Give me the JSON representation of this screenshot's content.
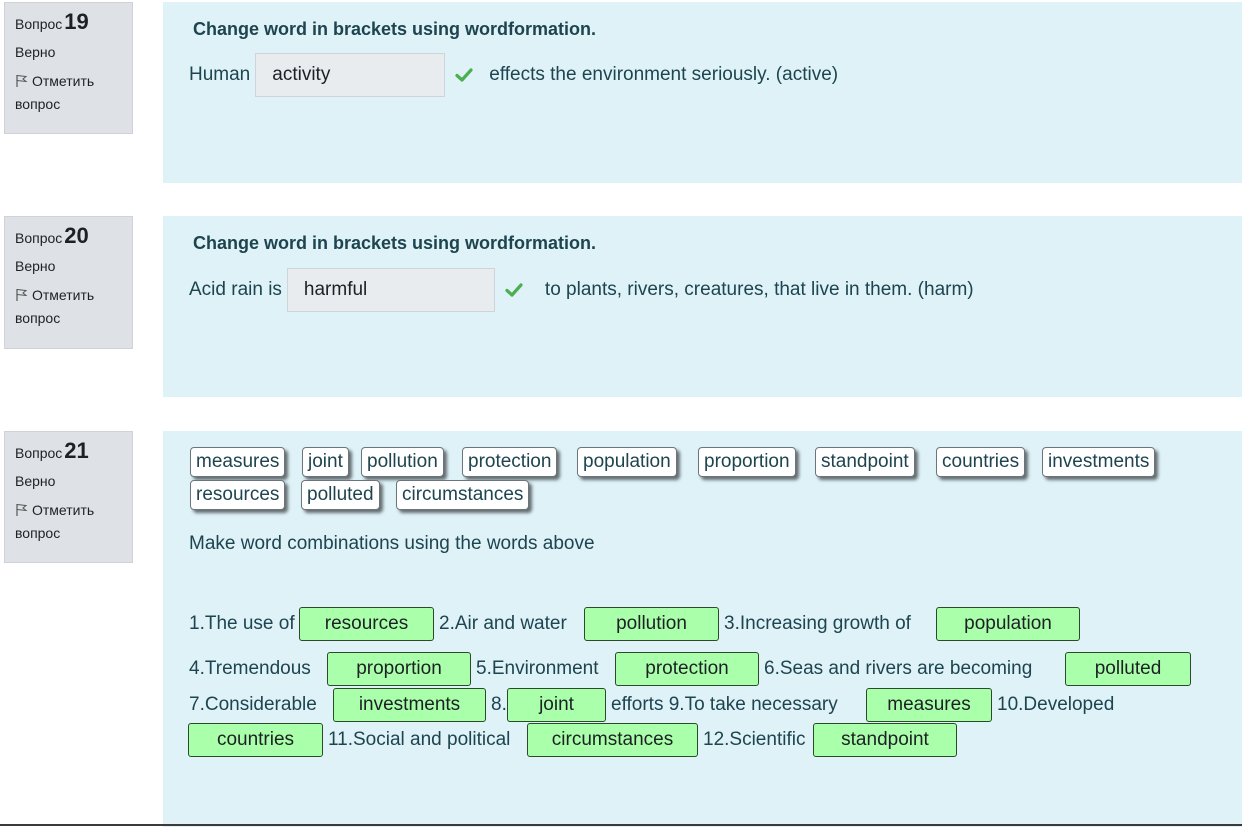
{
  "flag_label": "Отметить вопрос",
  "flag_icon": "flag-icon",
  "check_icon": "checkmark-icon",
  "colors": {
    "info_bg": "#dee2e6",
    "content_bg": "#def2f8",
    "drop_bg": "#aaffaa",
    "check": "#4caf50",
    "text": "#1e444f"
  },
  "questions": [
    {
      "label": "Вопрос",
      "number": "19",
      "state": "Верно",
      "title": "Change word in brackets using wordformation.",
      "before": "Human",
      "answer": "activity",
      "after": "effects the environment seriously. (active)"
    },
    {
      "label": "Вопрос",
      "number": "20",
      "state": "Верно",
      "title": "Change word in brackets using wordformation.",
      "before": "Acid rain is",
      "answer": "harmful",
      "after": "to plants, rivers, creatures, that live in them. (harm)"
    },
    {
      "label": "Вопрос",
      "number": "21",
      "state": "Верно",
      "chips": [
        "measures",
        "joint",
        "pollution",
        "protection",
        "population",
        "proportion",
        "standpoint",
        "countries",
        "investments",
        "resources",
        "polluted",
        "circumstances"
      ],
      "instruction": "Make word combinations using the words above",
      "texts": [
        "1.The use of",
        "2.Air and water",
        "3.Increasing growth of",
        "4.Tremendous",
        "5.Environment",
        "6.Seas and rivers are becoming",
        "7.Considerable",
        "8.",
        "efforts 9.To take necessary",
        "10.Developed",
        "11.Social and political",
        "12.Scientific"
      ],
      "drops": [
        "resources",
        "pollution",
        "population",
        "proportion",
        "protection",
        "polluted",
        "investments",
        "joint",
        "measures",
        "countries",
        "circumstances",
        "standpoint"
      ]
    }
  ]
}
